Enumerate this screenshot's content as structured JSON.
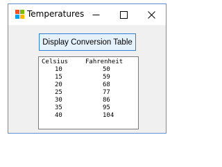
{
  "window": {
    "title": "Temperatures",
    "controls": {
      "minimize": "minimize-icon",
      "maximize": "maximize-icon",
      "close": "close-icon"
    },
    "app_icon": "form-app-icon"
  },
  "button": {
    "label": "Display Conversion Table"
  },
  "table": {
    "headers": [
      "Celsius",
      "Fahrenheit"
    ],
    "rows": [
      [
        "10",
        "50"
      ],
      [
        "15",
        "59"
      ],
      [
        "20",
        "68"
      ],
      [
        "25",
        "77"
      ],
      [
        "30",
        "86"
      ],
      [
        "35",
        "95"
      ],
      [
        "40",
        "104"
      ]
    ]
  },
  "colors": {
    "button_border": "#2f7fd6",
    "button_fill": "#e5f1fb",
    "window_border": "#5b8fd6"
  }
}
